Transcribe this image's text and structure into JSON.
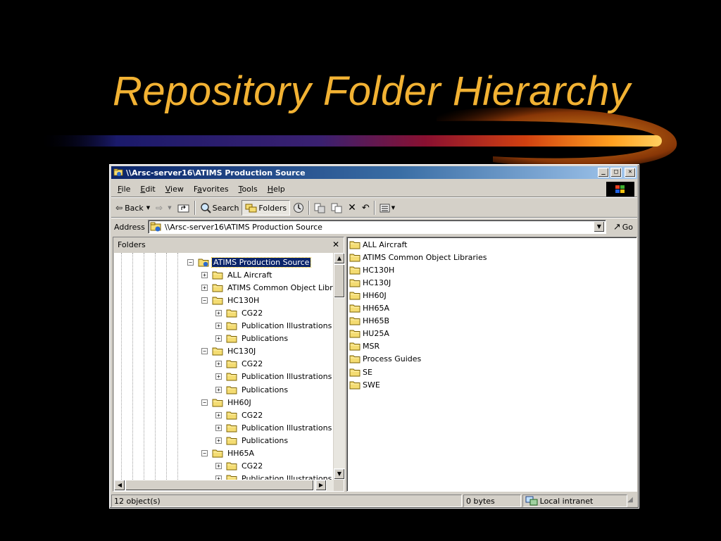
{
  "slide": {
    "title": "Repository Folder Hierarchy"
  },
  "window": {
    "title": "\\\\Arsc-server16\\ATIMS Production Source",
    "controls": {
      "minimize": "_",
      "maximize": "□",
      "close": "✕"
    }
  },
  "menubar": {
    "items": [
      {
        "label": "File",
        "mnemonic": "F"
      },
      {
        "label": "Edit",
        "mnemonic": "E"
      },
      {
        "label": "View",
        "mnemonic": "V"
      },
      {
        "label": "Favorites",
        "mnemonic": "a"
      },
      {
        "label": "Tools",
        "mnemonic": "T"
      },
      {
        "label": "Help",
        "mnemonic": "H"
      }
    ]
  },
  "toolbar": {
    "back_label": "Back",
    "search_label": "Search",
    "folders_label": "Folders"
  },
  "address": {
    "label": "Address",
    "value": "\\\\Arsc-server16\\ATIMS Production Source",
    "go_label": "Go"
  },
  "folders_pane": {
    "header": "Folders",
    "close_glyph": "✕",
    "tree": [
      {
        "label": "ATIMS Production Source",
        "expander": "−",
        "level": 0,
        "icon": "network-folder-icon",
        "selected": true
      },
      {
        "label": "ALL Aircraft",
        "expander": "+",
        "level": 1
      },
      {
        "label": "ATIMS Common Object Libra",
        "expander": "+",
        "level": 1
      },
      {
        "label": "HC130H",
        "expander": "−",
        "level": 1
      },
      {
        "label": "CG22",
        "expander": "+",
        "level": 2
      },
      {
        "label": "Publication Illustrations",
        "expander": "+",
        "level": 2
      },
      {
        "label": "Publications",
        "expander": "+",
        "level": 2
      },
      {
        "label": "HC130J",
        "expander": "−",
        "level": 1
      },
      {
        "label": "CG22",
        "expander": "+",
        "level": 2
      },
      {
        "label": "Publication Illustrations",
        "expander": "+",
        "level": 2
      },
      {
        "label": "Publications",
        "expander": "+",
        "level": 2
      },
      {
        "label": "HH60J",
        "expander": "−",
        "level": 1
      },
      {
        "label": "CG22",
        "expander": "+",
        "level": 2
      },
      {
        "label": "Publication Illustrations",
        "expander": "+",
        "level": 2
      },
      {
        "label": "Publications",
        "expander": "+",
        "level": 2
      },
      {
        "label": "HH65A",
        "expander": "−",
        "level": 1
      },
      {
        "label": "CG22",
        "expander": "+",
        "level": 2
      },
      {
        "label": "Publication Illustrations",
        "expander": "+",
        "level": 2
      }
    ]
  },
  "files_pane": {
    "items": [
      "ALL Aircraft",
      "ATIMS Common Object Libraries",
      "HC130H",
      "HC130J",
      "HH60J",
      "HH65A",
      "HH65B",
      "HU25A",
      "MSR",
      "Process Guides",
      "SE",
      "SWE"
    ]
  },
  "statusbar": {
    "objects": "12 object(s)",
    "size": "0 bytes",
    "zone": "Local intranet"
  },
  "colors": {
    "title_accent": "#f2b233",
    "window_face": "#d4d0c8",
    "titlebar_start": "#0a246a",
    "titlebar_end": "#a6caf0",
    "folder_yellow": "#f4dc72",
    "selection": "#0a246a"
  }
}
